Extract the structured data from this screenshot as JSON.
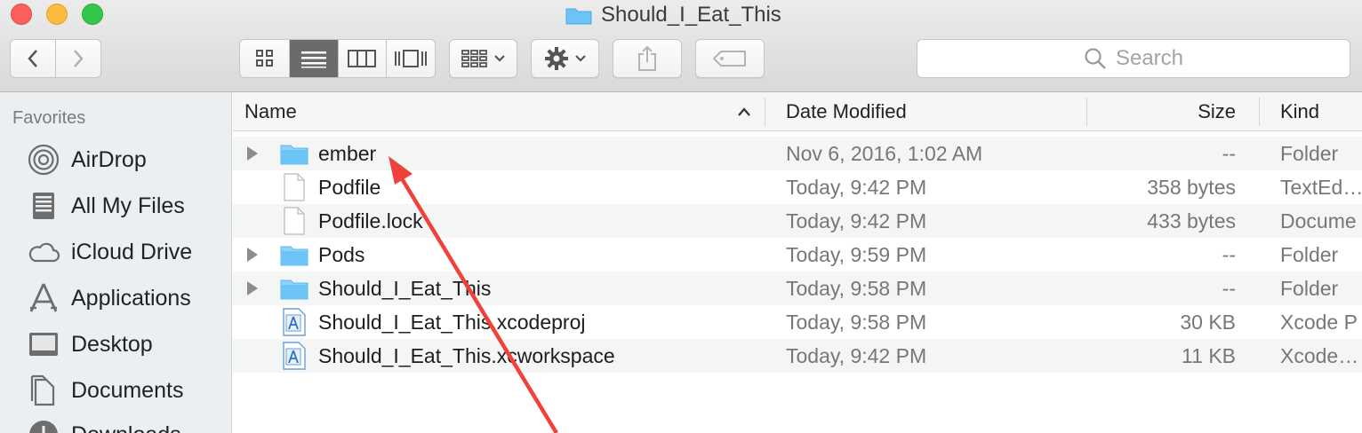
{
  "window": {
    "title": "Should_I_Eat_This"
  },
  "toolbar": {
    "search_placeholder": "Search"
  },
  "sidebar": {
    "heading": "Favorites",
    "items": [
      {
        "label": "AirDrop",
        "icon": "airdrop-icon"
      },
      {
        "label": "All My Files",
        "icon": "all-my-files-icon"
      },
      {
        "label": "iCloud Drive",
        "icon": "cloud-icon"
      },
      {
        "label": "Applications",
        "icon": "applications-icon"
      },
      {
        "label": "Desktop",
        "icon": "desktop-icon"
      },
      {
        "label": "Documents",
        "icon": "documents-icon"
      },
      {
        "label": "Downloads",
        "icon": "downloads-icon"
      }
    ]
  },
  "columns": {
    "name": "Name",
    "date": "Date Modified",
    "size": "Size",
    "kind": "Kind"
  },
  "files": [
    {
      "name": "ember",
      "date": "Nov 6, 2016, 1:02 AM",
      "size": "--",
      "kind": "Folder",
      "type": "folder"
    },
    {
      "name": "Podfile",
      "date": "Today, 9:42 PM",
      "size": "358 bytes",
      "kind": "TextEd…",
      "type": "doc"
    },
    {
      "name": "Podfile.lock",
      "date": "Today, 9:42 PM",
      "size": "433 bytes",
      "kind": "Docume",
      "type": "doc"
    },
    {
      "name": "Pods",
      "date": "Today, 9:59 PM",
      "size": "--",
      "kind": "Folder",
      "type": "folder"
    },
    {
      "name": "Should_I_Eat_This",
      "date": "Today, 9:58 PM",
      "size": "--",
      "kind": "Folder",
      "type": "folder"
    },
    {
      "name": "Should_I_Eat_This.xcodeproj",
      "date": "Today, 9:58 PM",
      "size": "30 KB",
      "kind": "Xcode P",
      "type": "xcode"
    },
    {
      "name": "Should_I_Eat_This.xcworkspace",
      "date": "Today, 9:42 PM",
      "size": "11 KB",
      "kind": "Xcode…",
      "type": "xcode"
    }
  ],
  "colors": {
    "folder": "#6cc3f5",
    "annotation_arrow": "#f0413a"
  }
}
